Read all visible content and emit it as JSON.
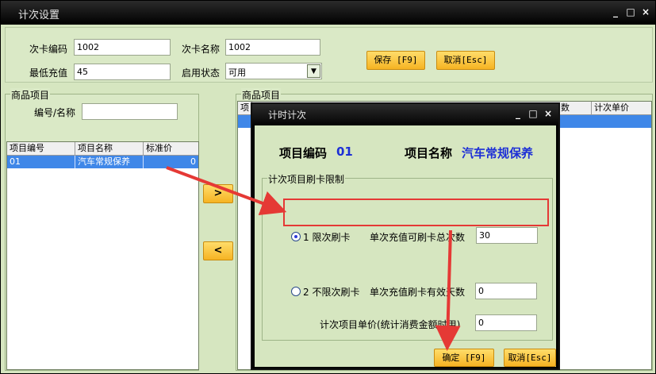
{
  "window": {
    "title": "计次设置",
    "controls": [
      "_",
      "□",
      "×"
    ]
  },
  "top_form": {
    "card_code_label": "次卡编码",
    "card_code_value": "1002",
    "card_name_label": "次卡名称",
    "card_name_value": "1002",
    "min_recharge_label": "最低充值",
    "min_recharge_value": "45",
    "status_label": "启用状态",
    "status_value": "可用",
    "save_label": "保存 [F9]",
    "cancel_label": "取消[Esc]"
  },
  "left_panel": {
    "title": "商品项目",
    "search_label": "编号/名称",
    "search_value": "",
    "columns": [
      "项目编号",
      "项目名称",
      "标准价"
    ],
    "rows": [
      {
        "code": "01",
        "name": "汽车常规保养",
        "price": "0"
      }
    ]
  },
  "transfer": {
    "add": ">",
    "remove": "<"
  },
  "right_panel": {
    "title": "商品项目",
    "visible_columns": [
      "项",
      "数",
      "计次单价"
    ]
  },
  "dialog": {
    "title": "计时计次",
    "controls": [
      "_",
      "□",
      "×"
    ],
    "item_code_label": "项目编码",
    "item_code_value": "01",
    "item_name_label": "项目名称",
    "item_name_value": "汽车常规保养",
    "group_title": "计次项目刷卡限制",
    "option1_label": "1  限次刷卡",
    "option1_field_label": "单次充值可刷卡总次数",
    "option1_value": "30",
    "option2_label": "2  不限次刷卡",
    "option2_field_label": "单次充值刷卡有效天数",
    "option2_value": "0",
    "unit_price_label": "计次项目单价(统计消费金额时用)",
    "unit_price_value": "0",
    "confirm_label": "确定 [F9]",
    "cancel_label": "取消[Esc]"
  },
  "colors": {
    "accent_orange": "#f6b323",
    "selection_blue": "#3f87e8",
    "annotation_red": "#e53935",
    "value_blue": "#1d2fd6"
  }
}
